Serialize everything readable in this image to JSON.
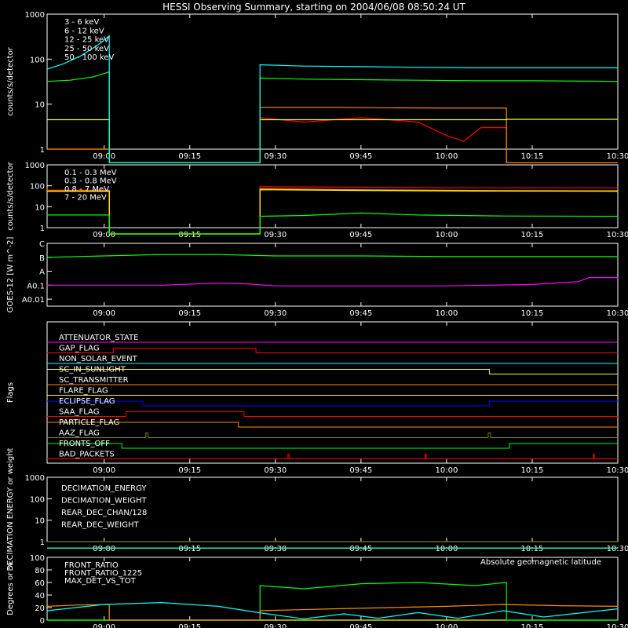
{
  "title": "HESSI Observing Summary, starting on 2004/06/08 08:50:24 UT",
  "x_axis": {
    "start_minutes": 0,
    "end_minutes": 100,
    "ticks": [
      {
        "label": "09:00",
        "minutes": 10
      },
      {
        "label": "09:15",
        "minutes": 25
      },
      {
        "label": "09:30",
        "minutes": 40
      },
      {
        "label": "09:45",
        "minutes": 55
      },
      {
        "label": "10:00",
        "minutes": 70
      },
      {
        "label": "10:15",
        "minutes": 85
      },
      {
        "label": "10:30",
        "minutes": 100
      }
    ]
  },
  "chart_data": [
    {
      "type": "line",
      "panel": "rates",
      "ylabel": "counts/s/detector",
      "yscale": "log",
      "ylim": [
        1,
        1000
      ],
      "ytick_labels": [
        "1",
        "10",
        "100",
        "1000"
      ],
      "legend_placement": "top-left",
      "series": [
        {
          "name": "3 - 6 keV",
          "color": "#ff0000",
          "x": [
            0,
            10.9,
            10.9,
            37.3,
            37.3,
            45,
            55,
            65,
            70,
            73,
            76,
            80.5,
            80.5,
            100
          ],
          "y": [
            1,
            1,
            0.5,
            0.5,
            5,
            4,
            5,
            4,
            2,
            1.5,
            3,
            3,
            0.5,
            0.5
          ]
        },
        {
          "name": "6 - 12 keV",
          "color": "#ff8c00",
          "x": [
            0,
            10.9,
            10.9,
            37.3,
            37.3,
            50,
            60,
            70,
            80.5,
            80.5,
            100
          ],
          "y": [
            1,
            1,
            0.5,
            0.5,
            8.5,
            8.5,
            8.3,
            8.2,
            8.2,
            0.5,
            0.5
          ]
        },
        {
          "name": "12 - 25 keV",
          "color": "#ffff00",
          "x": [
            0,
            5,
            10.9,
            10.9,
            37.3,
            37.3,
            45,
            55,
            65,
            75,
            80.5,
            80.5,
            90,
            100
          ],
          "y": [
            4.5,
            4.5,
            4.5,
            0.5,
            0.5,
            4.5,
            4.5,
            4.5,
            4.5,
            4.5,
            4.5,
            4.6,
            4.6,
            4.6
          ]
        },
        {
          "name": "25 - 50 keV",
          "color": "#00ff00",
          "x": [
            0,
            4,
            8,
            10.9,
            10.9,
            37.3,
            37.3,
            45,
            55,
            65,
            75,
            85,
            100
          ],
          "y": [
            32,
            34,
            40,
            52,
            0.5,
            0.5,
            38,
            36,
            35,
            34,
            33,
            33,
            32
          ]
        },
        {
          "name": "50 - 100 keV",
          "color": "#00ffff",
          "x": [
            0,
            3,
            6,
            9,
            10.9,
            10.9,
            37.3,
            37.3,
            45,
            55,
            65,
            75,
            85,
            100
          ],
          "y": [
            60,
            80,
            120,
            210,
            330,
            0.5,
            0.5,
            75,
            70,
            68,
            66,
            64,
            64,
            64
          ]
        }
      ]
    },
    {
      "type": "line",
      "panel": "rates-high",
      "ylabel": "counts/s/detector",
      "yscale": "log",
      "ylim": [
        1,
        1000
      ],
      "ytick_labels": [
        "1",
        "10",
        "100",
        "1000"
      ],
      "legend_placement": "top-left",
      "series": [
        {
          "name": "0.1 - 0.3 MeV",
          "color": "#ff0000",
          "x": [
            0,
            10.9,
            10.9,
            37.3,
            37.3,
            55,
            75,
            100
          ],
          "y": [
            62,
            62,
            0.5,
            0.5,
            90,
            85,
            80,
            80
          ]
        },
        {
          "name": "0.3 - 0.8 MeV",
          "color": "#ff8c00",
          "x": [
            0,
            10.9,
            10.9,
            37.3,
            37.3,
            55,
            75,
            100
          ],
          "y": [
            58,
            58,
            0.5,
            0.5,
            72,
            65,
            60,
            58
          ]
        },
        {
          "name": "0.8 - 7 MeV",
          "color": "#ffff00",
          "x": [
            0,
            10.9,
            10.9,
            37.3,
            37.3,
            55,
            75,
            100
          ],
          "y": [
            55,
            55,
            0.5,
            0.5,
            65,
            60,
            56,
            55
          ]
        },
        {
          "name": "7 - 20 MeV",
          "color": "#00ff00",
          "x": [
            0,
            10.9,
            10.9,
            37.3,
            37.3,
            45,
            55,
            65,
            80,
            100
          ],
          "y": [
            4,
            4,
            0.5,
            0.5,
            3.5,
            3.8,
            5,
            4,
            3.6,
            3.5
          ]
        }
      ]
    },
    {
      "type": "line",
      "panel": "goes",
      "ylabel": "GOES-12 [W m^-2]",
      "yscale": "class",
      "ytick_labels": [
        "A0.01",
        "A0.1",
        "A",
        "B",
        "C"
      ],
      "ylim_levels": [
        -0.5,
        4
      ],
      "series": [
        {
          "name": "",
          "color": "#00ff00",
          "x": [
            0,
            10,
            20,
            30,
            40,
            55,
            70,
            85,
            100
          ],
          "y": [
            3.0,
            3.1,
            3.2,
            3.2,
            3.1,
            3.1,
            3.05,
            3.05,
            3.05
          ]
        },
        {
          "name": "",
          "color": "#ff00ff",
          "x": [
            0,
            20,
            30,
            35,
            40,
            55,
            70,
            85,
            93,
            95,
            100
          ],
          "y": [
            1.0,
            1.0,
            1.15,
            1.1,
            0.95,
            0.95,
            0.95,
            1.05,
            1.25,
            1.55,
            1.55
          ]
        }
      ]
    },
    {
      "type": "line",
      "panel": "flags",
      "ylabel": "Flags",
      "flags": [
        {
          "name": "ATTENUATOR_STATE",
          "color": "#ff00ff",
          "x": [
            0,
            100
          ],
          "y": [
            0,
            0
          ]
        },
        {
          "name": "GAP_FLAG",
          "color": "#ff0000",
          "x": [
            0,
            11.6,
            11.6,
            36.6,
            36.6,
            100
          ],
          "y": [
            0,
            0,
            1,
            1,
            0,
            0
          ]
        },
        {
          "name": "NON_SOLAR_EVENT",
          "color": "#00ffff",
          "x": [
            0,
            100
          ],
          "y": [
            0,
            0
          ]
        },
        {
          "name": "SC_IN_SUNLIGHT",
          "color": "#ffff00",
          "x": [
            0,
            77.5,
            77.5,
            100
          ],
          "y": [
            1,
            1,
            0,
            0
          ]
        },
        {
          "name": "SC_TRANSMITTER",
          "color": "#ff8c00",
          "x": [
            0,
            100
          ],
          "y": [
            0,
            0
          ]
        },
        {
          "name": "FLARE_FLAG",
          "color": "#ffff00",
          "x": [
            0,
            100
          ],
          "y": [
            0,
            0
          ]
        },
        {
          "name": "ECLIPSE_FLAG",
          "color": "#0000ff",
          "x": [
            0,
            16.8,
            16.8,
            77.5,
            77.5,
            100
          ],
          "y": [
            1,
            1,
            0,
            0,
            1,
            1
          ]
        },
        {
          "name": "SAA_FLAG",
          "color": "#ff0000",
          "x": [
            0,
            13.8,
            13.8,
            34.5,
            34.5,
            100
          ],
          "y": [
            0,
            0,
            1,
            1,
            0,
            0
          ]
        },
        {
          "name": "PARTICLE_FLAG",
          "color": "#ff8c00",
          "x": [
            0,
            33.5,
            33.5,
            100
          ],
          "y": [
            1,
            1,
            0,
            0
          ]
        },
        {
          "name": "AAZ_FLAG",
          "color": "#808000",
          "x": [
            0,
            17.3,
            17.3,
            17.7,
            17.7,
            77.3,
            77.3,
            77.7,
            77.7,
            100
          ],
          "y": [
            0,
            0,
            1,
            1,
            0,
            0,
            1,
            1,
            0,
            0
          ]
        },
        {
          "name": "FRONTS_OFF",
          "color": "#00ff00",
          "x": [
            0,
            13.1,
            13.1,
            81.0,
            81.0,
            100
          ],
          "y": [
            1,
            1,
            0,
            0,
            1,
            1
          ]
        },
        {
          "name": "BAD_PACKETS",
          "color": "#ff0000",
          "x": [
            0,
            42.2,
            42.2,
            42.4,
            42.4,
            66.2,
            66.2,
            66.4,
            66.4,
            95.7,
            95.7,
            95.9,
            95.9,
            100
          ],
          "y": [
            0,
            0,
            1,
            1,
            0,
            0,
            1,
            1,
            0,
            0,
            1,
            1,
            0,
            0
          ]
        }
      ]
    },
    {
      "type": "line",
      "panel": "decimation",
      "ylabel": "DECIMATION ENERGY or weight",
      "yscale": "log",
      "ylim": [
        1,
        1000
      ],
      "ytick_labels": [
        "1",
        "10",
        "100",
        "1000"
      ],
      "legend_placement": "top-left",
      "series": [
        {
          "name": "DECIMATION_ENERGY",
          "color": "#00ff00",
          "x": [
            0,
            100
          ],
          "y": [
            0.5,
            0.5
          ]
        },
        {
          "name": "DECIMATION_WEIGHT",
          "color": "#ff8c00",
          "x": [
            0,
            100
          ],
          "y": [
            0.5,
            0.5
          ]
        },
        {
          "name": "REAR_DEC_CHAN/128",
          "color": "#00ffff",
          "x": [
            0,
            100
          ],
          "y": [
            0.5,
            0.5
          ]
        },
        {
          "name": "REAR_DEC_WEIGHT",
          "color": "#808000",
          "x": [
            0,
            100
          ],
          "y": [
            1,
            1
          ]
        }
      ]
    },
    {
      "type": "line",
      "panel": "ratios",
      "ylabel": "Degrees or %",
      "ylim": [
        0,
        100
      ],
      "ytick_labels": [
        "0",
        "20",
        "40",
        "60",
        "80",
        "100"
      ],
      "legend_placement": "top-left",
      "annotation": "Absolute geomagnetic latitude",
      "series": [
        {
          "name": "FRONT_RATIO",
          "color": "#ffff00",
          "x": [
            0,
            100
          ],
          "y": [
            0,
            0
          ]
        },
        {
          "name": "FRONT_RATIO_1225",
          "color": "#00ff00",
          "x": [
            0,
            10.9,
            10.9,
            37.3,
            37.3,
            45,
            55,
            65,
            75,
            80.5,
            80.5,
            100
          ],
          "y": [
            0,
            0,
            0,
            0,
            55,
            50,
            58,
            60,
            55,
            60,
            0,
            0
          ]
        },
        {
          "name": "MAX_DET_VS_TOT",
          "color": "#ff8c00",
          "x": [
            0,
            5,
            10.9,
            10.9,
            37.3,
            37.3,
            50,
            60,
            70,
            80,
            90,
            100
          ],
          "y": [
            22,
            24,
            25,
            0,
            0,
            15,
            18,
            20,
            22,
            25,
            23,
            22
          ]
        },
        {
          "name": "Absolute geomagnetic latitude",
          "color": "#00ffff",
          "x": [
            0,
            10,
            20,
            30,
            37,
            45,
            52,
            58,
            65,
            72,
            80,
            87,
            94,
            100
          ],
          "y": [
            15,
            25,
            28,
            22,
            12,
            2,
            10,
            3,
            12,
            3,
            15,
            5,
            12,
            18
          ]
        }
      ]
    }
  ]
}
